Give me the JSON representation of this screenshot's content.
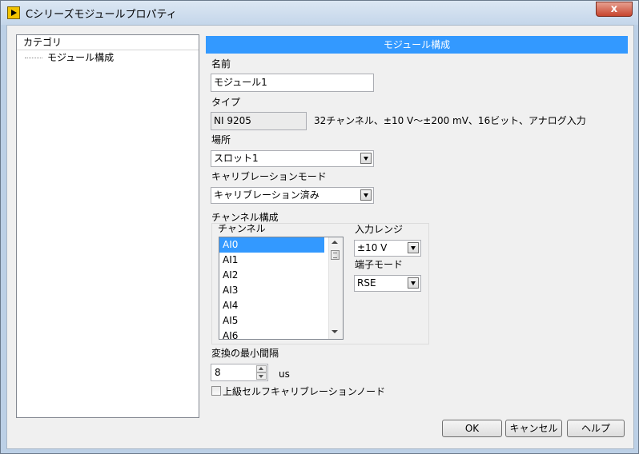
{
  "window": {
    "title": "Cシリーズモジュールプロパティ",
    "close_label": "x"
  },
  "category": {
    "header": "カテゴリ",
    "items": [
      "モジュール構成"
    ]
  },
  "section": {
    "title": "モジュール構成"
  },
  "name": {
    "label": "名前",
    "value": "モジュール1"
  },
  "type": {
    "label": "タイプ",
    "value": "NI 9205",
    "description": "32チャンネル、±10 V～±200 mV、16ビット、アナログ入力"
  },
  "location": {
    "label": "場所",
    "value": "スロット1"
  },
  "calibration_mode": {
    "label": "キャリブレーションモード",
    "value": "キャリブレーション済み"
  },
  "channel_config": {
    "label": "チャンネル構成",
    "channel_label": "チャンネル",
    "channels": [
      "AI0",
      "AI1",
      "AI2",
      "AI3",
      "AI4",
      "AI5",
      "AI6"
    ],
    "selected": "AI0",
    "input_range_label": "入力レンジ",
    "input_range_value": "±10 V",
    "terminal_mode_label": "端子モード",
    "terminal_mode_value": "RSE"
  },
  "min_conversion": {
    "label": "変換の最小間隔",
    "value": "8",
    "unit": "us"
  },
  "advanced": {
    "label": "上級セルフキャリブレーションノード",
    "checked": false
  },
  "buttons": {
    "ok": "OK",
    "cancel": "キャンセル",
    "help": "ヘルプ"
  },
  "colors": {
    "accent": "#3399ff",
    "titlebar": "#c4d6ea",
    "close": "#c7452e"
  },
  "icons": {
    "app": "labview-icon",
    "close": "close-icon"
  }
}
